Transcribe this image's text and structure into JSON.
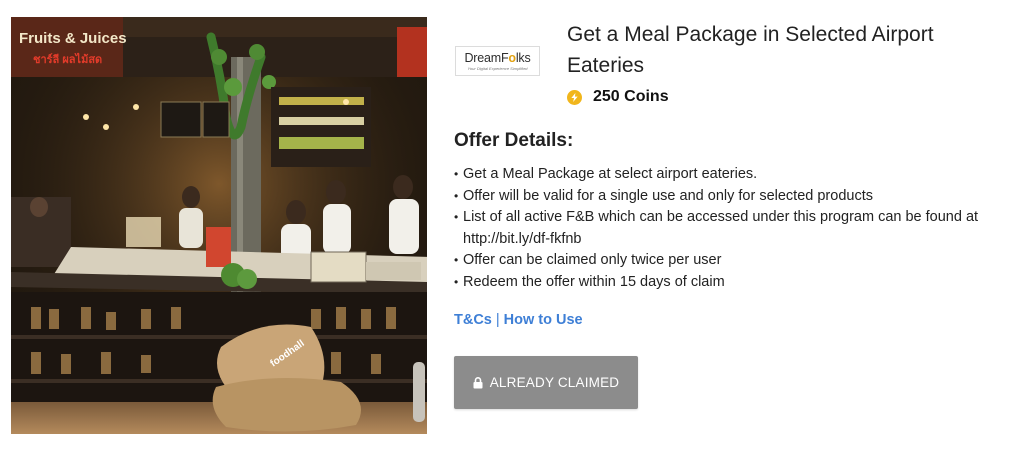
{
  "product": {
    "image_alt": "Airport food court kiosk",
    "title": "Get a Meal Package in Selected Airport Eateries",
    "partner_logo": {
      "name": "DreamFolks",
      "name_part1": "DreamF",
      "name_o": "o",
      "name_part2": "lks",
      "tagline": "Your Digital Experience Simplified"
    },
    "price": {
      "amount": "250 Coins",
      "icon": "coin-icon",
      "color": "#f1b61c"
    }
  },
  "photo_signs": {
    "sign_left": "Fruits & Juices",
    "sign_left_sub": "ชาร์ลี ผลไม้สด",
    "bag_text": "foodhall"
  },
  "offer": {
    "heading": "Offer Details:",
    "items": [
      "Get a Meal Package at select airport eateries.",
      "Offer will be valid for a single use and only for selected products",
      "List of all active F&B which can be accessed under this program can be found at http://bit.ly/df-fkfnb",
      "Offer can be claimed only twice per user",
      "Redeem the offer within 15 days of claim"
    ]
  },
  "links": {
    "tcs": "T&Cs",
    "separator": "|",
    "how_to_use": "How to Use",
    "color": "#3e7fd6"
  },
  "action": {
    "label": "ALREADY CLAIMED",
    "icon": "lock-icon",
    "background": "#8c8c8c"
  }
}
